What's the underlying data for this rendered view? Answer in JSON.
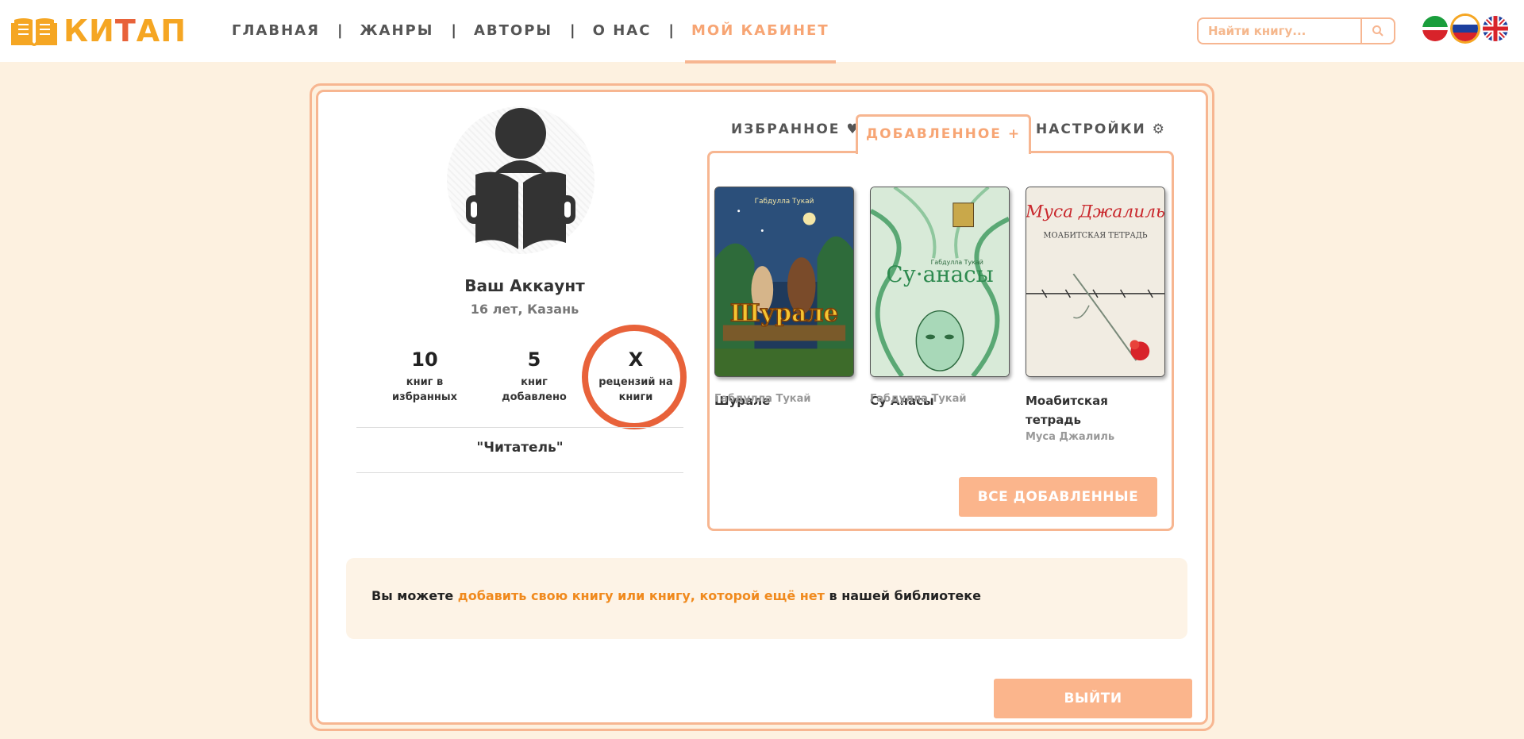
{
  "brand": {
    "name_part1": "КИ",
    "name_part2": "Т",
    "name_part3": "АП"
  },
  "nav": {
    "items": [
      {
        "label": "ГЛАВНАЯ"
      },
      {
        "label": "ЖАНРЫ"
      },
      {
        "label": "АВТОРЫ"
      },
      {
        "label": "О НАС"
      },
      {
        "label": "МОЙ КАБИНЕТ"
      }
    ],
    "separator": "|",
    "active_item": "МОЙ КАБИНЕТ"
  },
  "search": {
    "placeholder": "Найти книгу..."
  },
  "languages": [
    {
      "code": "tt",
      "icon": "tatarstan-flag-icon"
    },
    {
      "code": "ru",
      "icon": "russia-flag-icon",
      "selected": true
    },
    {
      "code": "en",
      "icon": "uk-flag-icon"
    }
  ],
  "profile": {
    "name": "Ваш Аккаунт",
    "meta": "16 лет, Казань",
    "stats": [
      {
        "value": "10",
        "label_line1": "книг в",
        "label_line2": "избранных"
      },
      {
        "value": "5",
        "label_line1": "книг",
        "label_line2": "добавлено"
      },
      {
        "value": "X",
        "label_line1": "рецензий на",
        "label_line2": "книги"
      }
    ],
    "role": "\"Читатель\""
  },
  "tabs": {
    "favorites": "ИЗБРАННОЕ ♥",
    "added": "ДОБАВЛЕННОЕ +",
    "settings": "НАСТРОЙКИ ⚙",
    "active": "ДОБАВЛЕННОЕ +"
  },
  "books": [
    {
      "title_line1": "Шурале",
      "title_line2": "",
      "author": "Габдулла Тукай",
      "cover_text": "Шурале",
      "cover_author": "Габдулла Тукай"
    },
    {
      "title_line1": "Су Анасы",
      "title_line2": "",
      "author": "Габдулла Тукай",
      "cover_text": "Су·анасы",
      "cover_author": "Габдулла Тукай"
    },
    {
      "title_line1": "Моабитская",
      "title_line2": "тетрадь",
      "author": "Муса Джалиль",
      "cover_text": "Муса Джалиль",
      "cover_subtitle": "МОАБИТСКАЯ ТЕТРАДЬ"
    }
  ],
  "all_added_button": "ВСЕ ДОБАВЛЕННЫЕ",
  "info": {
    "prefix": "Вы можете ",
    "link": "добавить свою книгу или книгу, которой ещё нет",
    "suffix": " в нашей библиотеке"
  },
  "logout_button": "ВЫЙТИ",
  "colors": {
    "accent": "#f7b691",
    "brand": "#f5a623",
    "highlight": "#e8623a",
    "link": "#f08a1e",
    "background": "#fdf1e0"
  }
}
